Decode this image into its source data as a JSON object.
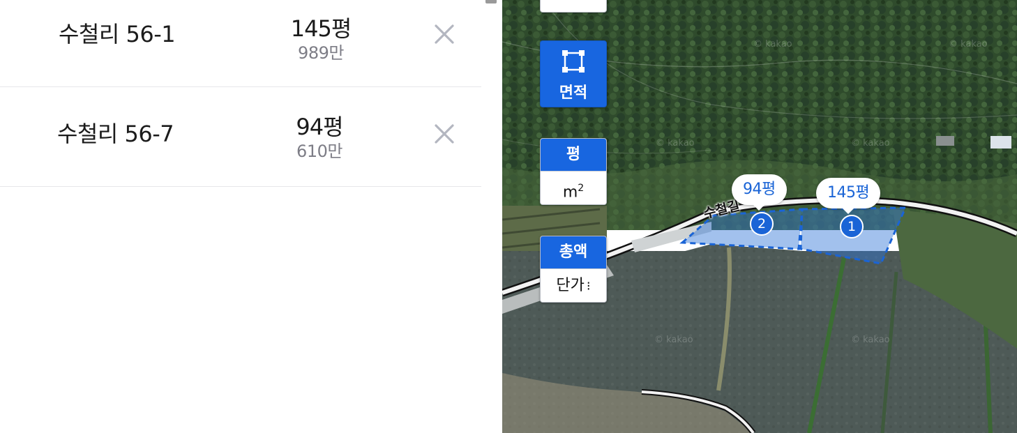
{
  "parcels": [
    {
      "address": "수철리 56-1",
      "area": "145평",
      "price": "989만"
    },
    {
      "address": "수철리 56-7",
      "area": "94평",
      "price": "610만"
    }
  ],
  "map_controls": {
    "area_tool_label": "면적",
    "unit_toggle": {
      "selected": "평",
      "other_base": "m",
      "other_exp": "2"
    },
    "price_toggle": {
      "selected": "총액",
      "other": "단가"
    }
  },
  "map": {
    "watermark": "© kakao",
    "road_label": "수철길",
    "parcel_bubbles": [
      {
        "number": "1",
        "area": "145평"
      },
      {
        "number": "2",
        "area": "94평"
      }
    ],
    "colors": {
      "accent": "#1866e0",
      "parcel_fill": "rgba(49,118,214,0.45)"
    }
  }
}
